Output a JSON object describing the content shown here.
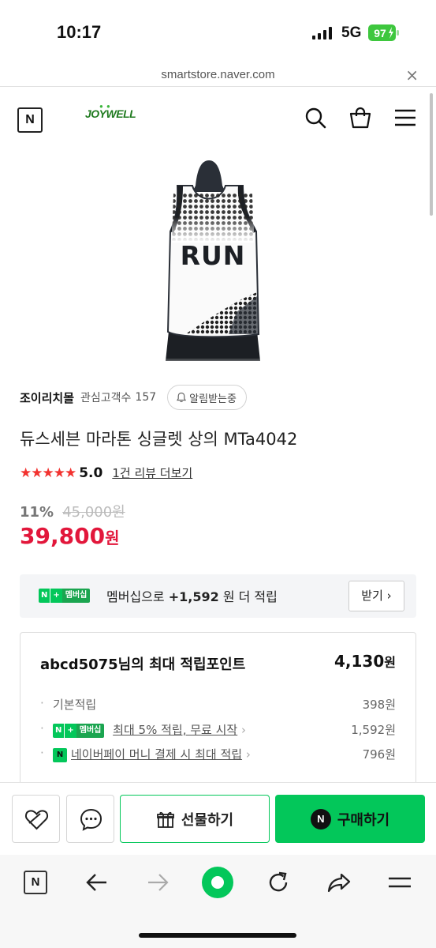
{
  "status_bar": {
    "time": "10:17",
    "network": "5G",
    "battery": "97"
  },
  "browser": {
    "url": "smartstore.naver.com",
    "close_glyph": "×"
  },
  "header": {
    "n_logo": "N",
    "brand": "JOYWELL"
  },
  "store": {
    "name": "조이리치몰",
    "customers_label": "관심고객수",
    "customers_count": "157",
    "alarm_label": "알림받는중"
  },
  "product": {
    "title": "듀스세븐 마라톤 싱글렛 상의 MTa4042",
    "stars": "★★★★★",
    "rating": "5.0",
    "review_link": "1건 리뷰 더보기",
    "print_text": "RUN",
    "discount": "11%",
    "original_price": "45,000원",
    "price": "39,800",
    "price_unit": "원"
  },
  "membership": {
    "badge_n": "N",
    "badge_plus": "+",
    "badge_label": "멤버십",
    "prefix": "멤버십으로",
    "points": "+1,592",
    "suffix": "원 더 적립",
    "button": "받기"
  },
  "points": {
    "title": "abcd5075님의 최대 적립포인트",
    "total": "4,130",
    "total_unit": "원",
    "rows": [
      {
        "label": "기본적립",
        "value": "398원"
      },
      {
        "label": "최대 5% 적립, 무료 시작",
        "value": "1,592원"
      },
      {
        "label": "네이버페이 머니 결제 시 최대 적립",
        "value": "796원"
      }
    ],
    "npay_badge": "N"
  },
  "actions": {
    "gift": "선물하기",
    "buy": "구매하기",
    "buy_badge": "N"
  },
  "toolbar": {
    "n_label": "N"
  },
  "colors": {
    "naver_green": "#03c75a",
    "price_red": "#e2173b",
    "star_red": "#f2322f"
  },
  "icons": [
    "search-icon",
    "cart-icon",
    "menu-icon",
    "bell-icon",
    "heart-icon",
    "chat-icon",
    "gift-icon",
    "back-icon",
    "forward-icon",
    "refresh-icon",
    "share-icon",
    "tabs-icon"
  ]
}
